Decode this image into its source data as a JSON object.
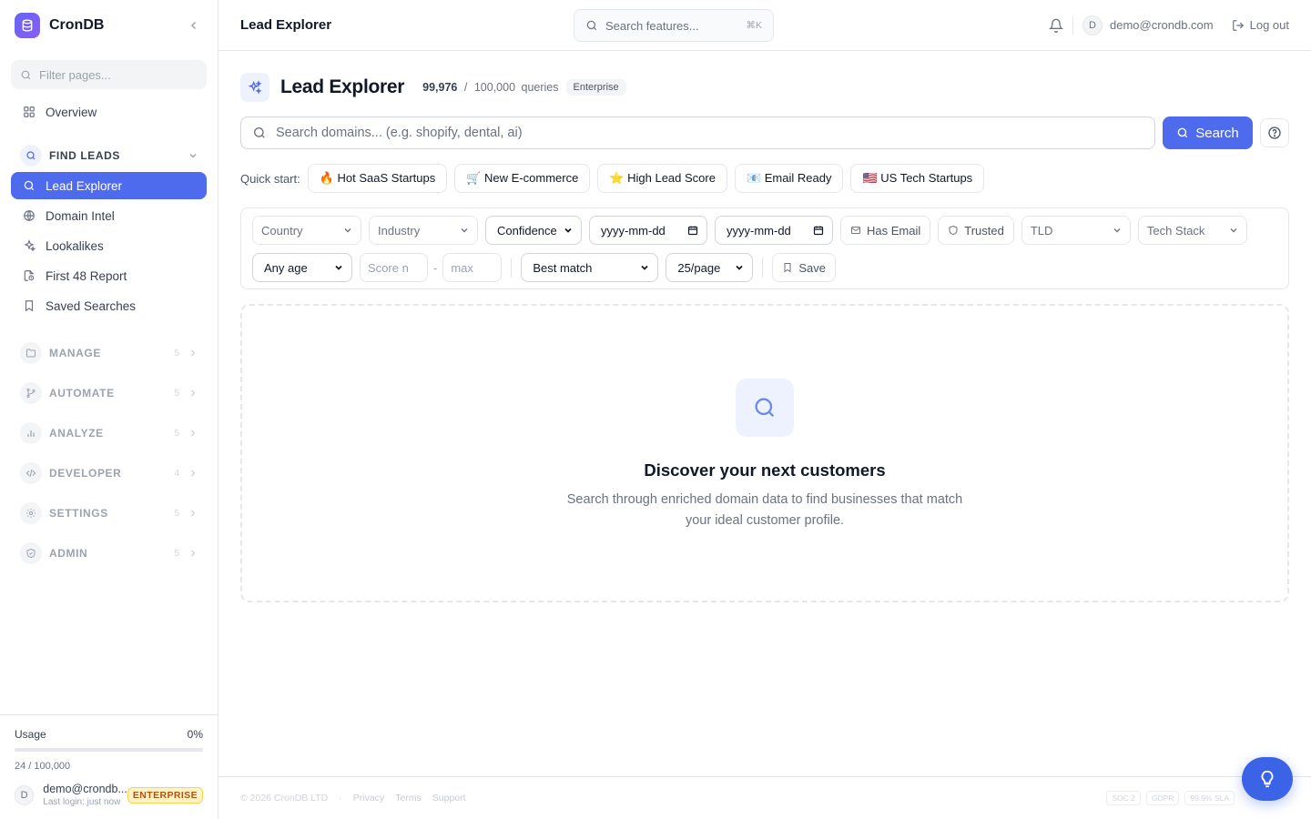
{
  "brand": {
    "name": "CronDB"
  },
  "sidebar": {
    "filter_placeholder": "Filter pages...",
    "overview": "Overview",
    "find_leads": {
      "label": "FIND LEADS",
      "items": [
        "Lead Explorer",
        "Domain Intel",
        "Lookalikes",
        "First 48 Report",
        "Saved Searches"
      ]
    },
    "sections": [
      {
        "label": "MANAGE",
        "count": "5"
      },
      {
        "label": "AUTOMATE",
        "count": "5"
      },
      {
        "label": "ANALYZE",
        "count": "5"
      },
      {
        "label": "DEVELOPER",
        "count": "4"
      },
      {
        "label": "SETTINGS",
        "count": "5"
      },
      {
        "label": "ADMIN",
        "count": "5"
      }
    ],
    "usage": {
      "label": "Usage",
      "percent_text": "0%",
      "fill_fraction": 0.0,
      "count_text": "24 / 100,000"
    },
    "user": {
      "initial": "D",
      "email": "demo@crondb...",
      "last_login": "Last login: just now",
      "plan": "ENTERPRISE"
    }
  },
  "header": {
    "title": "Lead Explorer",
    "feature_search_placeholder": "Search features...",
    "feature_search_kbd": "⌘K",
    "user_initial": "D",
    "user_email": "demo@crondb.com",
    "logout": "Log out"
  },
  "main": {
    "title": "Lead Explorer",
    "quota_used": "99,976",
    "quota_sep": "/",
    "quota_total": "100,000",
    "quota_unit": "queries",
    "plan": "Enterprise",
    "search_placeholder": "Search domains... (e.g. shopify, dental, ai)",
    "search_button": "Search",
    "quick_start_label": "Quick start:",
    "quick_start": [
      "🔥 Hot SaaS Startups",
      "🛒 New E-commerce",
      "⭐ High Lead Score",
      "📧 Email Ready",
      "🇺🇸 US Tech Startups"
    ],
    "filters": {
      "country": "Country",
      "industry": "Industry",
      "confidence": "Confidence",
      "date_from": "yyyy-mm-dd",
      "date_to": "yyyy-mm-dd",
      "has_email": "Has Email",
      "trusted": "Trusted",
      "tld": "TLD",
      "tech_stack": "Tech Stack",
      "age": "Any age",
      "score_min_placeholder": "Score n",
      "score_sep": "-",
      "score_max_placeholder": "max",
      "sort": "Best match",
      "per_page": "25/page",
      "save": "Save"
    },
    "empty": {
      "title": "Discover your next customers",
      "text": "Search through enriched domain data to find businesses that match your ideal customer profile."
    }
  },
  "footer": {
    "copyright": "© 2026 CronDB LTD",
    "dot": "·",
    "links": [
      "Privacy",
      "Terms",
      "Support"
    ],
    "badges": [
      "SOC 2",
      "GDPR",
      "99.9% SLA"
    ]
  },
  "colors": {
    "accent": "#4f6bed",
    "fab": "#3b63e6",
    "enterprise": "#b45309"
  }
}
